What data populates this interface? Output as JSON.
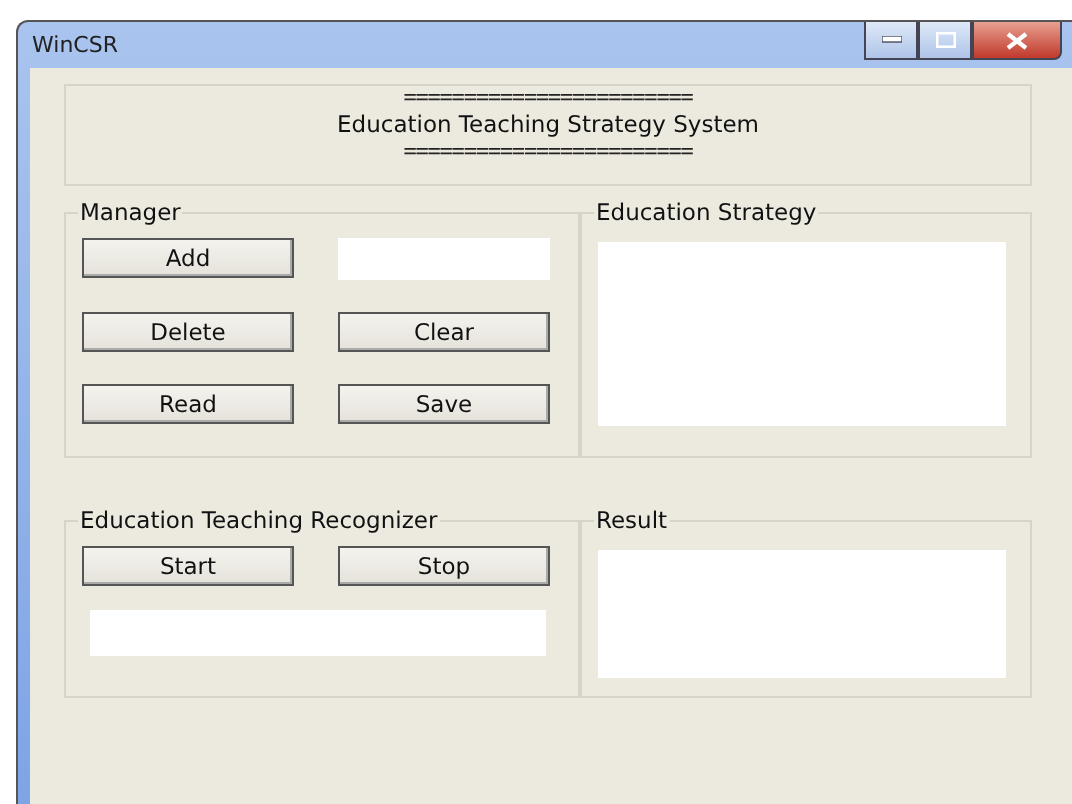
{
  "window": {
    "title": "WinCSR"
  },
  "header": {
    "rule_top": "========================",
    "title": "Education Teaching Strategy System",
    "rule_bottom": "========================"
  },
  "manager": {
    "label": "Manager",
    "buttons": [
      "Add",
      "Delete",
      "Clear",
      "Read",
      "Save"
    ]
  },
  "strategy": {
    "label": "Education Strategy"
  },
  "recognizer": {
    "label": "Education Teaching Recognizer",
    "buttons": [
      "Start",
      "Stop"
    ]
  },
  "result": {
    "label": "Result"
  }
}
